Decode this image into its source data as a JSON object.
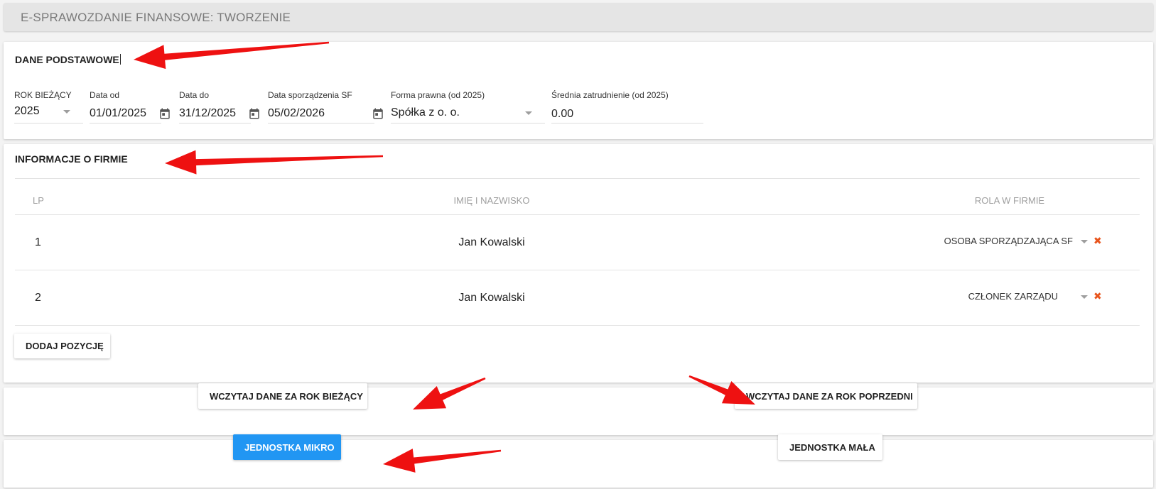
{
  "header": {
    "title": "E-SPRAWOZDANIE FINANSOWE: TWORZENIE"
  },
  "basic": {
    "title": "DANE PODSTAWOWE",
    "fields": {
      "rok": {
        "label": "ROK BIEŻĄCY",
        "value": "2025"
      },
      "data_od": {
        "label": "Data od",
        "value": "01/01/2025"
      },
      "data_do": {
        "label": "Data do",
        "value": "31/12/2025"
      },
      "data_sf": {
        "label": "Data sporządzenia SF",
        "value": "05/02/2026"
      },
      "forma": {
        "label": "Forma prawna (od 2025)",
        "value": "Spółka z o. o."
      },
      "zatrudnienie": {
        "label": "Średnia zatrudnienie (od 2025)",
        "value": "0.00"
      }
    }
  },
  "firm": {
    "title": "INFORMACJE O FIRMIE",
    "columns": {
      "lp": "LP",
      "name": "IMIĘ I NAZWISKO",
      "role": "ROLA W FIRMIE"
    },
    "rows": [
      {
        "lp": "1",
        "name": "Jan Kowalski",
        "role": "OSOBA SPORZĄDZAJĄCA SF"
      },
      {
        "lp": "2",
        "name": "Jan Kowalski",
        "role": "CZŁONEK ZARZĄDU"
      }
    ],
    "add_label": "DODAJ POZYCJĘ"
  },
  "load": {
    "current_label": "WCZYTAJ DANE ZA ROK BIEŻĄCY",
    "previous_label": "WCZYTAJ DANE ZA ROK POPRZEDNI"
  },
  "unit": {
    "micro_label": "JEDNOSTKA MIKRO",
    "small_label": "JEDNOSTKA MAŁA"
  },
  "colors": {
    "primary": "#2196f3",
    "delete": "#e8541c",
    "annotation": "#ee1111"
  },
  "icons": {
    "calendar": "calendar-icon",
    "dropdown": "chevron-down-icon",
    "delete": "close-icon"
  }
}
